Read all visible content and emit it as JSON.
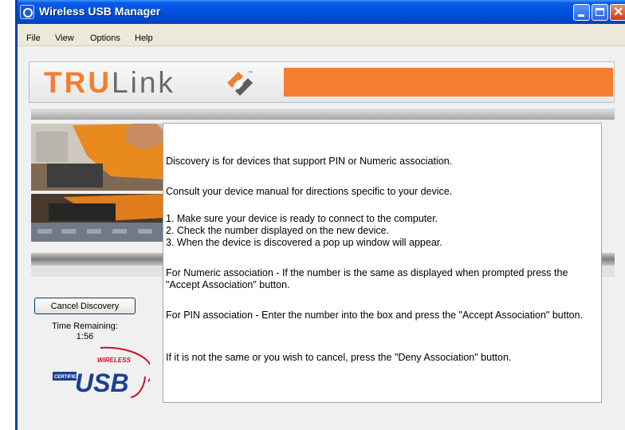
{
  "window": {
    "title": "Wireless USB Manager"
  },
  "menu": [
    "File",
    "View",
    "Options",
    "Help"
  ],
  "brand": {
    "logo_part1": "TRU",
    "logo_part2": "Link",
    "trademark": "™",
    "accent": "#f37e2f"
  },
  "sidebar": {
    "cancel_button": "Cancel Discovery",
    "time_label": "Time Remaining:",
    "time_value": "1:56",
    "badge": {
      "top": "WIRELESS",
      "main": "USB",
      "left": "CERTIFIED"
    }
  },
  "content": {
    "intro": "Discovery is for devices that support PIN or Numeric association.",
    "manual_note": "Consult your device manual for directions specific to your device.",
    "steps": [
      "1.  Make sure your device is ready to connect to the computer.",
      "2.  Check the number displayed on the new device.",
      "3.  When the device is discovered a pop up window will appear."
    ],
    "numeric_note": "For Numeric association - If the number is the same as displayed when prompted press the \"Accept Association\" button.",
    "pin_note": "For PIN association - Enter the number into the box and press the \"Accept Association\" button.",
    "deny_note": "If it is not the same or you wish to cancel, press the \"Deny Association\" button."
  }
}
